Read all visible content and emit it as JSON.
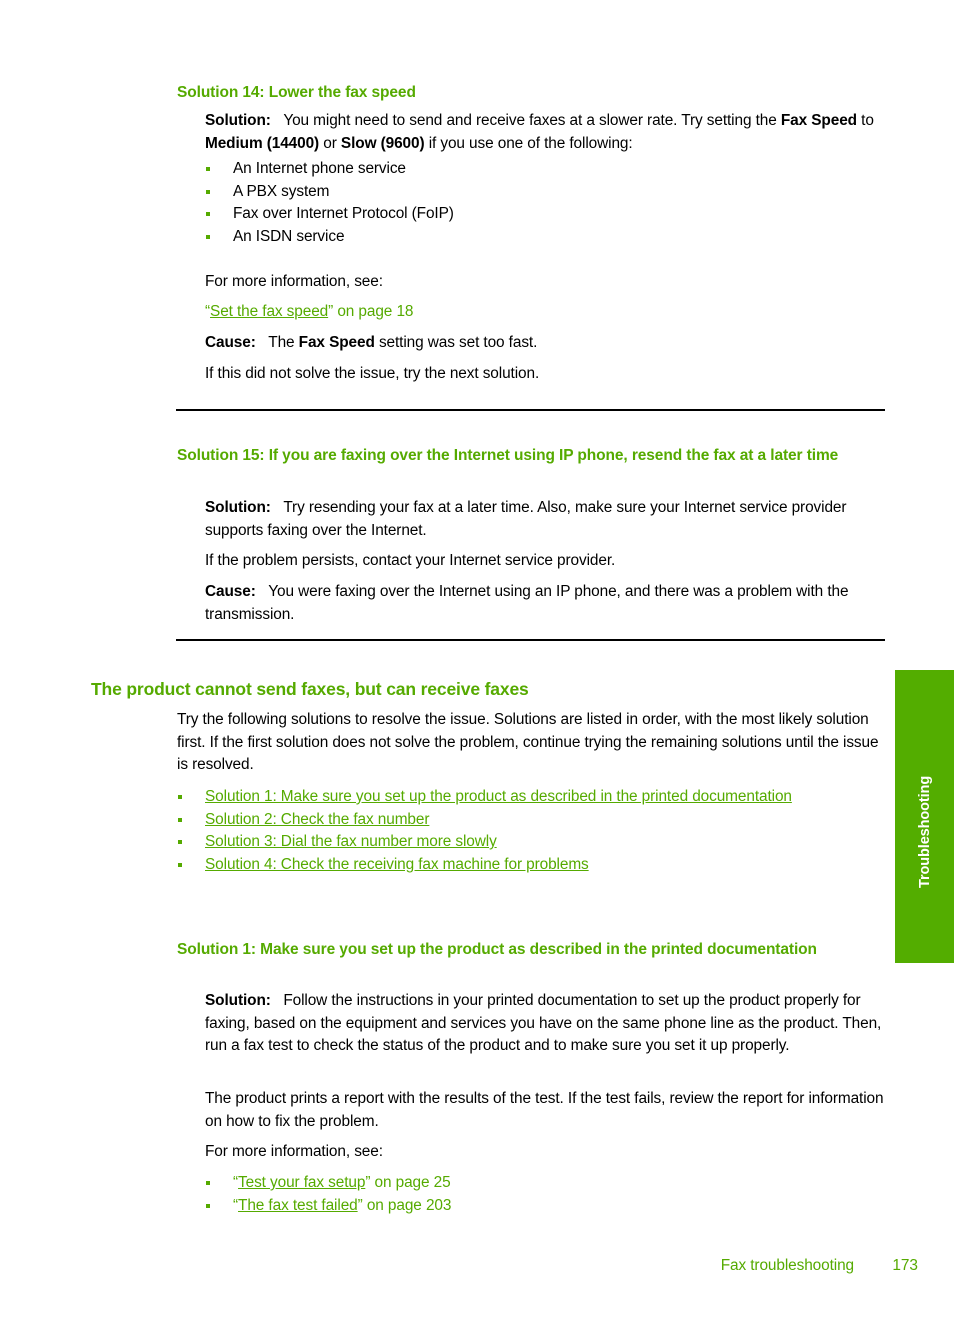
{
  "colors": {
    "heading_green": "#55aa00",
    "link_green": "#55aa00",
    "tab_green": "#53ad00",
    "body_black": "#000000"
  },
  "section_14": {
    "heading": "Solution 14: Lower the fax speed",
    "solution_label": "Solution:",
    "solution_text_1": "You might need to send and receive faxes at a slower rate. Try setting the ",
    "solution_bold_1": "Fax Speed",
    "solution_text_2": " to ",
    "solution_bold_2": "Medium (14400)",
    "solution_text_3": " or ",
    "solution_bold_3": "Slow (9600)",
    "solution_text_4": " if you use one of the following:",
    "bullets": [
      "An Internet phone service",
      "A PBX system",
      "Fax over Internet Protocol (FoIP)",
      "An ISDN service"
    ],
    "more_info": "For more information, see:",
    "xref_open_quote": "“",
    "xref_title": "Set the fax speed",
    "xref_close_quote": "”",
    "xref_page": " on page 18",
    "cause_label": "Cause:",
    "cause_text_1": "The ",
    "cause_bold": "Fax Speed",
    "cause_text_2": " setting was set too fast.",
    "next_solution": "If this did not solve the issue, try the next solution."
  },
  "section_15": {
    "heading": "Solution 15: If you are faxing over the Internet using IP phone, resend the fax at a later time",
    "solution_label": "Solution:",
    "solution_text": "Try resending your fax at a later time. Also, make sure your Internet service provider supports faxing over the Internet.",
    "persist_text": "If the problem persists, contact your Internet service provider.",
    "cause_label": "Cause:",
    "cause_text": "You were faxing over the Internet using an IP phone, and there was a problem with the transmission."
  },
  "main_section": {
    "heading": "The product cannot send faxes, but can receive faxes",
    "intro": "Try the following solutions to resolve the issue. Solutions are listed in order, with the most likely solution first. If the first solution does not solve the problem, continue trying the remaining solutions until the issue is resolved.",
    "links": [
      "Solution 1: Make sure you set up the product as described in the printed documentation",
      "Solution 2: Check the fax number",
      "Solution 3: Dial the fax number more slowly",
      "Solution 4: Check the receiving fax machine for problems"
    ]
  },
  "solution_1": {
    "heading": "Solution 1: Make sure you set up the product as described in the printed documentation",
    "solution_label": "Solution:",
    "solution_text": "Follow the instructions in your printed documentation to set up the product properly for faxing, based on the equipment and services you have on the same phone line as the product. Then, run a fax test to check the status of the product and to make sure you set it up properly.",
    "report_text": "The product prints a report with the results of the test. If the test fails, review the report for information on how to fix the problem.",
    "more_info": "For more information, see:",
    "xrefs": [
      {
        "open_quote": "“",
        "title": "Test your fax setup",
        "close_quote": "”",
        "page": " on page 25"
      },
      {
        "open_quote": "“",
        "title": "The fax test failed",
        "close_quote": "”",
        "page": " on page 203"
      }
    ]
  },
  "side_tab": {
    "label": "Troubleshooting"
  },
  "footer": {
    "label": "Fax troubleshooting",
    "page_number": "173"
  }
}
